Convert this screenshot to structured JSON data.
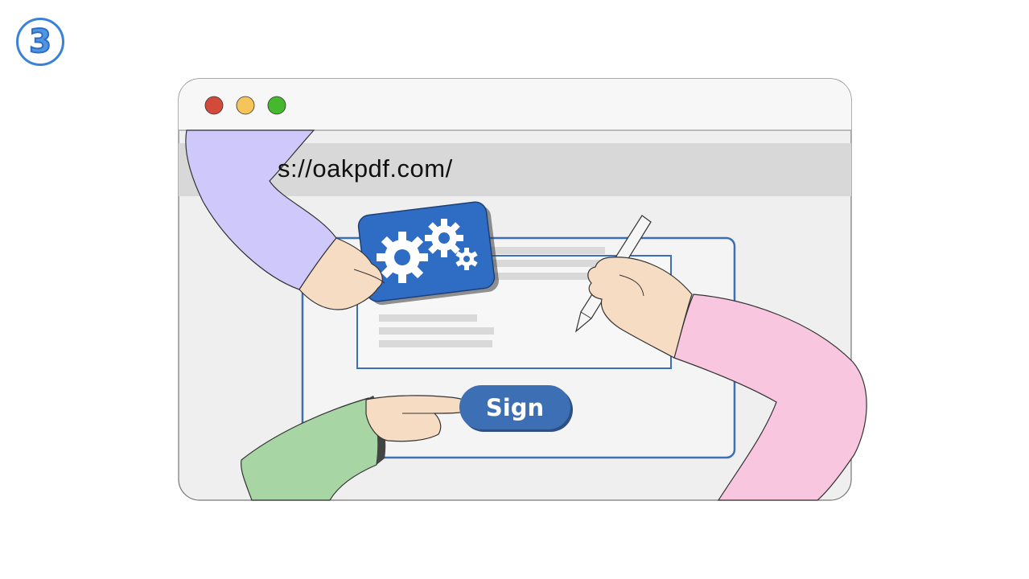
{
  "step": {
    "number": "3"
  },
  "browser": {
    "controls": [
      "close-dot",
      "minimize-dot",
      "maximize-dot"
    ],
    "url": "s://oakpdf.com/"
  },
  "document": {
    "sign_button_label": "Sign"
  },
  "colors": {
    "accent_blue": "#3d6fb4",
    "dot_red": "#d44a3a",
    "dot_yellow": "#f5c45a",
    "dot_green": "#46b82e",
    "sleeve_purple": "#cfc9fb",
    "sleeve_pink": "#f9c6e0",
    "sleeve_green": "#a8d5a4",
    "skin": "#f7dcc4"
  }
}
